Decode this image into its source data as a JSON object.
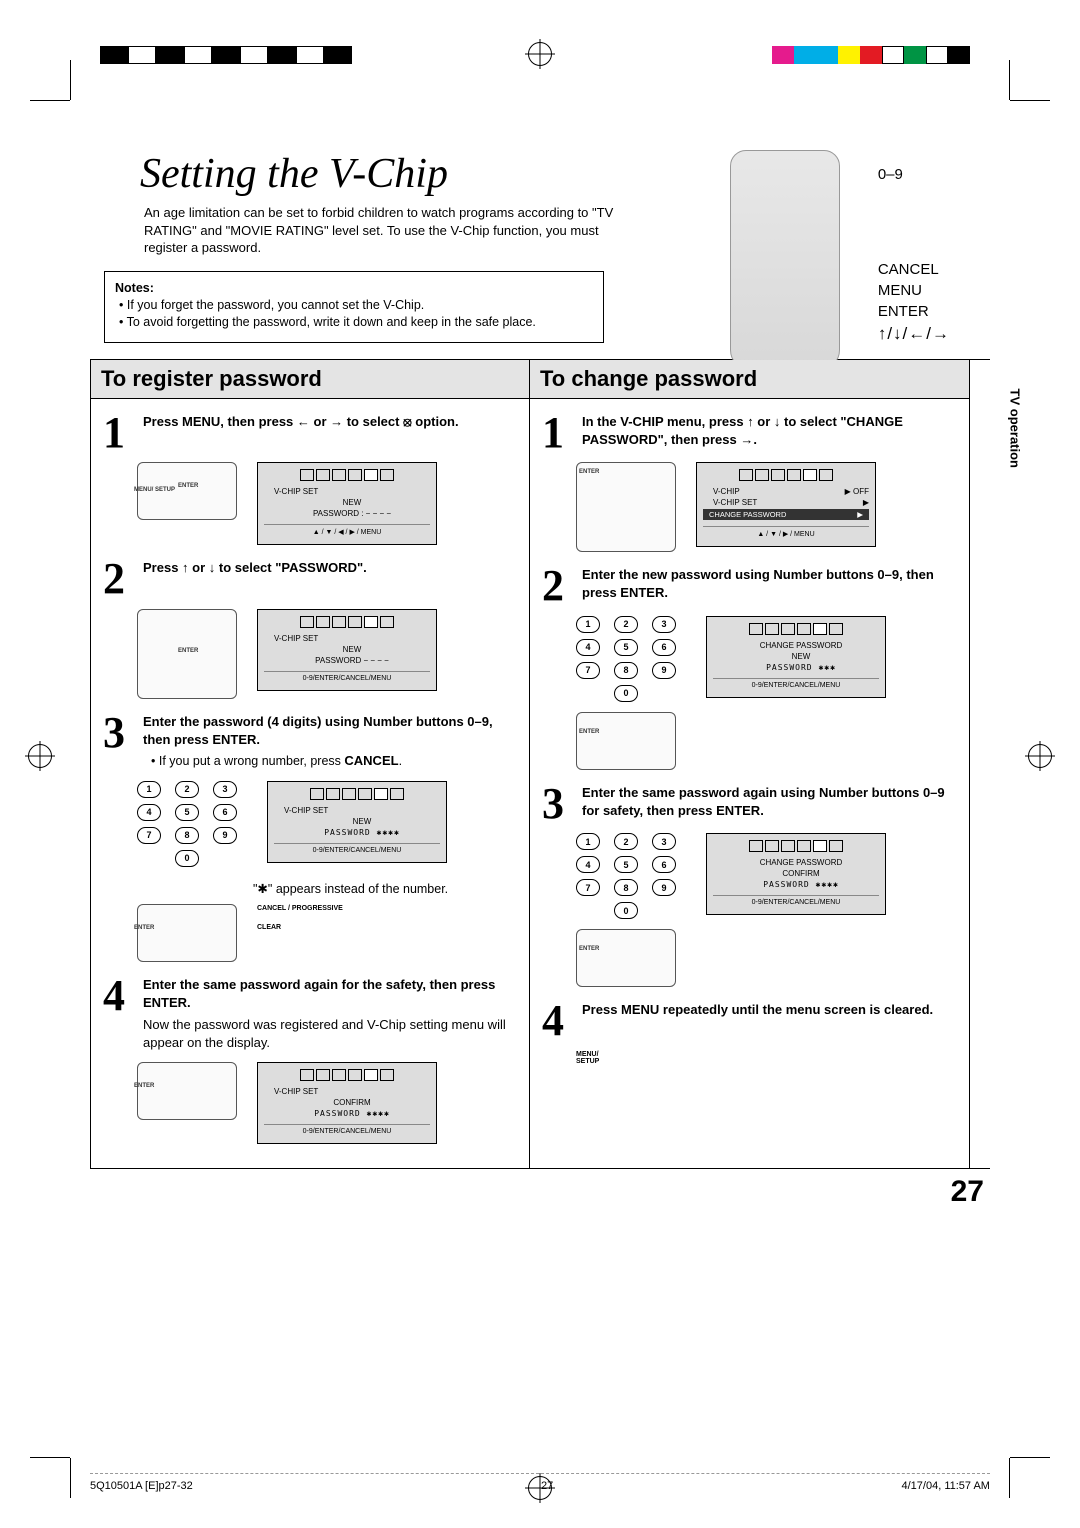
{
  "pageNumber": "27",
  "sidebarTab": "TV operation",
  "imprint": {
    "file": "5Q10501A [E]p27-32",
    "pg": "27",
    "date": "4/17/04, 11:57 AM"
  },
  "title": "Setting the V-Chip",
  "intro": "An age limitation can be set to forbid children to watch programs according to \"TV RATING\" and \"MOVIE RATING\" level set. To use the V-Chip function, you must register a password.",
  "notes": {
    "heading": "Notes:",
    "items": [
      "If you forget the password, you cannot set the V-Chip.",
      "To avoid forgetting the password, write it down and keep in the safe place."
    ]
  },
  "remoteLabels": {
    "numbers": "0–9",
    "cancel": "CANCEL",
    "menu": "MENU",
    "enter": "ENTER",
    "arrows": "↑/↓/←/→"
  },
  "left": {
    "heading": "To register password",
    "step1": "Press MENU, then press ← or → to select ⦻ option.",
    "step2": "Press ↑ or ↓ to select \"PASSWORD\".",
    "step3a": "Enter the password (4 digits) using Number buttons 0–9, then press ENTER.",
    "step3b": "If you put a wrong number, press",
    "step3c": "CANCEL",
    "step3d": "\"✱\" appears instead of the number.",
    "step4a": "Enter the same password again for the safety, then press ENTER.",
    "step4b": "Now the password was registered and V-Chip setting menu will appear on the display.",
    "osd1": {
      "l1": "V-CHIP SET",
      "l2": "NEW",
      "l3": "PASSWORD    : − − − −",
      "foot": "▲ / ▼ / ◀ / ▶ / MENU"
    },
    "osd2": {
      "l1": "V-CHIP SET",
      "l2": "NEW",
      "l3": "PASSWORD    − − − −",
      "foot": "0-9/ENTER/CANCEL/MENU"
    },
    "osd3": {
      "l1": "V-CHIP SET",
      "l2": "NEW",
      "l3": "PASSWORD   ✱✱✱✱",
      "foot": "0-9/ENTER/CANCEL/MENU"
    },
    "osd4": {
      "l1": "V-CHIP SET",
      "l2": "CONFIRM",
      "l3": "PASSWORD   ✱✱✱✱",
      "foot": "0-9/ENTER/CANCEL/MENU"
    },
    "btn_menu": "MENU/\nSETUP",
    "btn_enter": "ENTER",
    "btn_cancel": "CANCEL /\nPROGRESSIVE",
    "btn_clear": "CLEAR"
  },
  "right": {
    "heading": "To change password",
    "step1": "In the V-CHIP menu, press ↑ or ↓ to select \"CHANGE PASSWORD\", then press →.",
    "step2": "Enter the new password using Number buttons 0–9, then press ENTER.",
    "step3": "Enter the same password again using Number buttons 0–9 for safety, then press ENTER.",
    "step4": "Press MENU repeatedly until the menu screen is cleared.",
    "osd1": {
      "l1": "V-CHIP",
      "l1r": "▶ OFF",
      "l2": "V-CHIP SET",
      "l2r": "▶",
      "l3": "CHANGE PASSWORD",
      "l3r": "▶",
      "foot": "▲ / ▼ / ▶ / MENU"
    },
    "osd2": {
      "l1": "CHANGE  PASSWORD",
      "l2": "NEW",
      "l3": "PASSWORD   ✱✱✱",
      "foot": "0-9/ENTER/CANCEL/MENU"
    },
    "osd3": {
      "l1": "CHANGE  PASSWORD",
      "l2": "CONFIRM",
      "l3": "PASSWORD   ✱✱✱✱",
      "foot": "0-9/ENTER/CANCEL/MENU"
    },
    "btn_menu": "MENU/\nSETUP",
    "btn_enter": "ENTER"
  },
  "numpad": [
    "1",
    "2",
    "3",
    "4",
    "5",
    "6",
    "7",
    "8",
    "9",
    "0"
  ]
}
